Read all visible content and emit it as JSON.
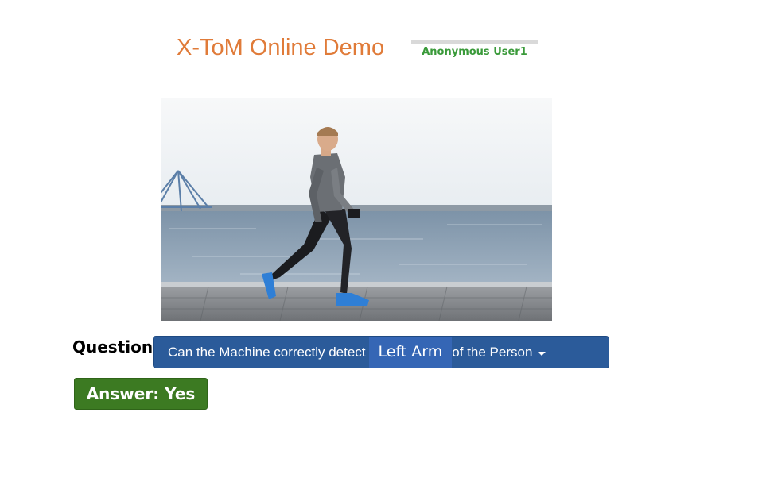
{
  "header": {
    "title": "X-ToM Online Demo",
    "user": "Anonymous User1"
  },
  "image": {
    "alt": "Man walking along a waterfront promenade",
    "icon": "photo-image"
  },
  "question": {
    "label": "Question:",
    "prefix": "Can the Machine correctly detect",
    "part": "Left Arm",
    "suffix": "of the Person",
    "dropdown_icon": "caret-down-icon"
  },
  "answer": {
    "label": "Answer: Yes"
  },
  "colors": {
    "title": "#e07b39",
    "user": "#3a9a3a",
    "question_bg": "#2b5b9a",
    "question_part_bg": "#3566b5",
    "answer_bg": "#3c7a22"
  }
}
